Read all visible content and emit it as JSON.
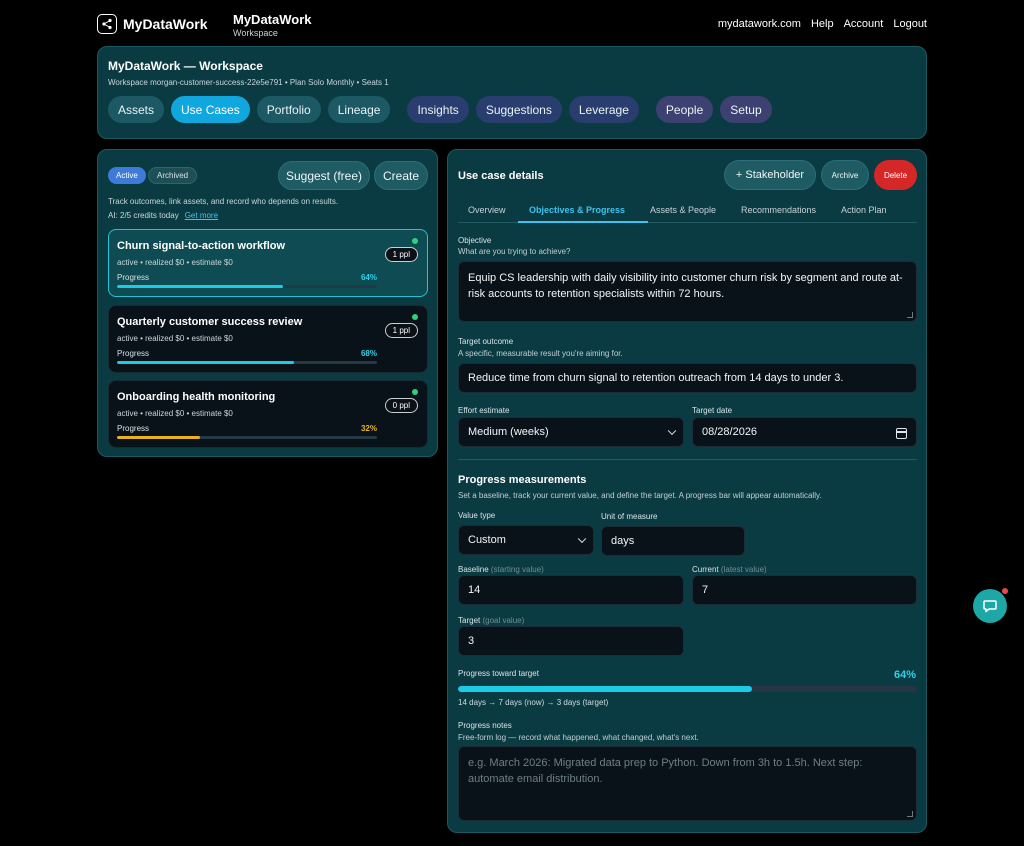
{
  "topbar": {
    "brand": "MyDataWork",
    "title": "MyDataWork",
    "subtitle": "Workspace",
    "nav": [
      "mydatawork.com",
      "Help",
      "Account",
      "Logout"
    ]
  },
  "workspace": {
    "title": "MyDataWork — Workspace",
    "meta": "Workspace morgan-customer-success-22e5e791 • Plan Solo Monthly • Seats 1",
    "tabs": [
      "Assets",
      "Use Cases",
      "Portfolio",
      "Lineage",
      "Insights",
      "Suggestions",
      "Leverage",
      "People",
      "Setup"
    ],
    "active_tab": "Use Cases"
  },
  "left": {
    "filter_active": "Active",
    "filter_archived": "Archived",
    "suggest_label": "Suggest (free)",
    "create_label": "Create",
    "description": "Track outcomes, link assets, and record who depends on results.",
    "credits": "AI: 2/5 credits today",
    "get_more": "Get more",
    "progress_label": "Progress",
    "use_cases": [
      {
        "title": "Churn signal-to-action workflow",
        "meta": "active • realized $0 • estimate $0",
        "people": "1 ppl",
        "progress": 64,
        "progress_text": "64%",
        "color": "#1ecbe5",
        "selected": true
      },
      {
        "title": "Quarterly customer success review",
        "meta": "active • realized $0 • estimate $0",
        "people": "1 ppl",
        "progress": 68,
        "progress_text": "68%",
        "color": "#1ecbe5",
        "selected": false
      },
      {
        "title": "Onboarding health monitoring",
        "meta": "active • realized $0 • estimate $0",
        "people": "0 ppl",
        "progress": 32,
        "progress_text": "32%",
        "color": "#e8b21c",
        "selected": false
      }
    ]
  },
  "details": {
    "title": "Use case details",
    "stakeholder_label": "+ Stakeholder",
    "archive_label": "Archive",
    "delete_label": "Delete",
    "tabs": [
      "Overview",
      "Objectives & Progress",
      "Assets & People",
      "Recommendations",
      "Action Plan"
    ],
    "active_tab": "Objectives & Progress",
    "objective_label": "Objective",
    "objective_hint": "What are you trying to achieve?",
    "objective_value": "Equip CS leadership with daily visibility into customer churn risk by segment and route at-risk accounts to retention specialists within 72 hours.",
    "target_outcome_label": "Target outcome",
    "target_outcome_hint": "A specific, measurable result you're aiming for.",
    "target_outcome_value": "Reduce time from churn signal to retention outreach from 14 days to under 3.",
    "effort_label": "Effort estimate",
    "effort_value": "Medium (weeks)",
    "target_date_label": "Target date",
    "target_date_value": "08/28/2026",
    "progress_section_title": "Progress measurements",
    "progress_section_hint": "Set a baseline, track your current value, and define the target. A progress bar will appear automatically.",
    "value_type_label": "Value type",
    "value_type_value": "Custom",
    "unit_label": "Unit of measure",
    "unit_value": "days",
    "baseline_label": "Baseline",
    "baseline_hint": "(starting value)",
    "baseline_value": "14",
    "current_label": "Current",
    "current_hint": "(latest value)",
    "current_value": "7",
    "target_label": "Target",
    "target_hint": "(goal value)",
    "target_value": "3",
    "progress_toward_label": "Progress toward target",
    "progress_toward_pct": "64%",
    "progress_toward_value": 64,
    "progress_summary": "14 days → 7 days (now) → 3 days (target)",
    "notes_label": "Progress notes",
    "notes_hint": "Free-form log — record what happened, what changed, what's next.",
    "notes_placeholder": "e.g. March 2026: Migrated data prep to Python. Down from 3h to 1.5h. Next step: automate email distribution."
  },
  "colors": {
    "panel": "#0b3b42",
    "accent": "#10a7de",
    "delete": "#d52727",
    "progress": "#1dcbe5",
    "warning": "#e8b21c",
    "online": "#2fd07a"
  },
  "icons": {
    "logo": "share-nodes-icon",
    "chat": "chat-bubble-icon"
  }
}
